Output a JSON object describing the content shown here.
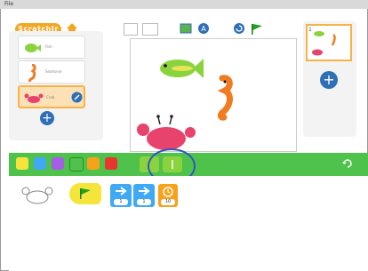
{
  "menubar": {
    "file_label": "File"
  },
  "app": {
    "logo_text": "ScratchJr"
  },
  "sprites": [
    {
      "name": "Fish",
      "color": "#8ad33e"
    },
    {
      "name": "Seahorse",
      "color": "#f07c22"
    },
    {
      "name": "Crab",
      "color": "#e8436c",
      "selected": true
    }
  ],
  "pages": {
    "current": "1"
  },
  "script": {
    "blocks": [
      {
        "type": "flag-trigger"
      },
      {
        "type": "move-right",
        "value": "1"
      },
      {
        "type": "move-right",
        "value": "1"
      },
      {
        "type": "wait",
        "value": "10"
      }
    ]
  },
  "palette": {
    "categories": [
      {
        "name": "triggering",
        "color": "#f5e53b"
      },
      {
        "name": "motion",
        "color": "#3fa9f5"
      },
      {
        "name": "looks",
        "color": "#a55ee8"
      },
      {
        "name": "sound",
        "color": "#4ec24a"
      },
      {
        "name": "control",
        "color": "#f7a21a"
      },
      {
        "name": "end",
        "color": "#e8362f"
      }
    ]
  }
}
